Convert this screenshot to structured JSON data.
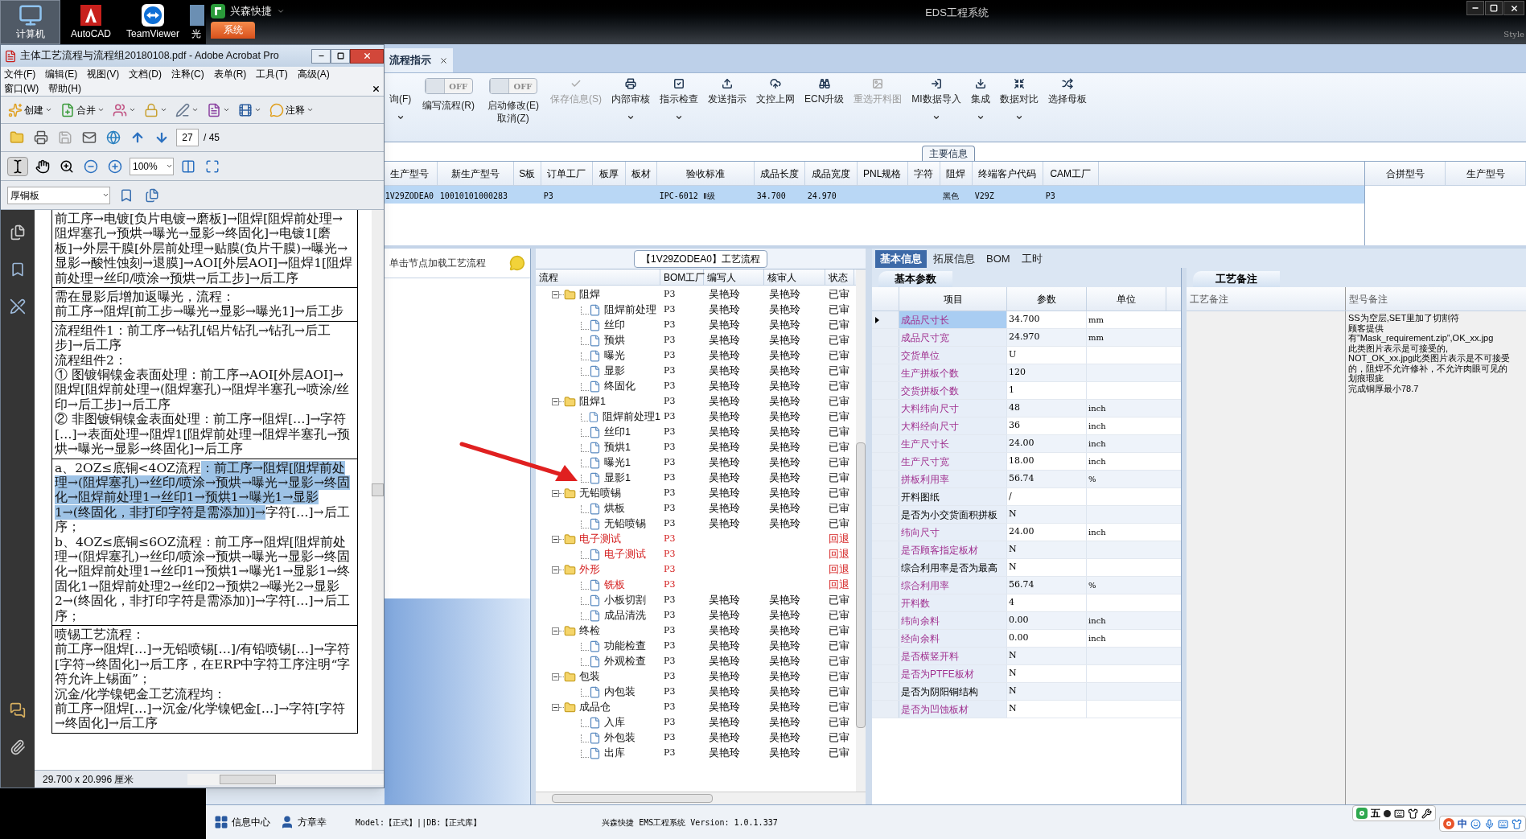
{
  "desktop": {
    "icons": [
      {
        "label": "计算机",
        "selected": true
      },
      {
        "label": "AutoCAD",
        "selected": false
      },
      {
        "label": "TeamViewer",
        "selected": false
      },
      {
        "label": "光",
        "selected": false
      }
    ]
  },
  "eds": {
    "app_name": "兴森快捷",
    "system_tab": "系统",
    "title": "EDS工程系统",
    "style_label": "Style",
    "doc_tab": {
      "label": "流程指示"
    },
    "ribbon": [
      {
        "kind": "button",
        "label": "询(F)",
        "disabled": false,
        "dropdown": true
      },
      {
        "kind": "toggle",
        "state_text": "OFF",
        "on": false,
        "label": "编写流程(R)"
      },
      {
        "kind": "toggle",
        "state_text": "OFF",
        "on": false,
        "label": "启动修改(E)",
        "sublabel": "取消(Z)"
      },
      {
        "kind": "button",
        "label": "保存信息(S)",
        "disabled": true,
        "dropdown": false
      },
      {
        "kind": "button",
        "label": "内部审核",
        "disabled": false,
        "dropdown": true
      },
      {
        "kind": "button",
        "label": "指示检查",
        "disabled": false,
        "dropdown": true
      },
      {
        "kind": "button",
        "label": "发送指示",
        "disabled": false,
        "dropdown": false
      },
      {
        "kind": "button",
        "label": "文控上网",
        "disabled": false,
        "dropdown": false
      },
      {
        "kind": "button",
        "label": "ECN升级",
        "disabled": false,
        "dropdown": false
      },
      {
        "kind": "button",
        "label": "重选开料图",
        "disabled": true,
        "dropdown": false
      },
      {
        "kind": "button",
        "label": "MI数据导入",
        "disabled": false,
        "dropdown": true
      },
      {
        "kind": "button",
        "label": "集成",
        "disabled": false,
        "dropdown": true
      },
      {
        "kind": "button",
        "label": "数据对比",
        "disabled": false,
        "dropdown": true
      },
      {
        "kind": "button",
        "label": "选择母板",
        "disabled": false,
        "dropdown": false
      }
    ],
    "group_label": "主要信息",
    "main_table": {
      "columns": [
        "生产型号",
        "新生产型号",
        "S板",
        "订单工厂",
        "板厚",
        "板材",
        "验收标准",
        "成品长度",
        "成品宽度",
        "PNL规格",
        "字符",
        "阻焊",
        "终端客户代码",
        "CAM工厂"
      ],
      "rows": [
        {
          "selected": true,
          "cells": [
            "1V29ZODEA0",
            "10010101000283",
            "",
            "P3",
            "",
            "",
            "IPC-6012 Ⅱ级",
            "34.700",
            "24.970",
            "",
            "",
            "黑色",
            "V29Z",
            "P3"
          ]
        }
      ]
    },
    "merge_panel": {
      "columns": [
        "合拼型号",
        "生产型号"
      ]
    },
    "left_panel": {
      "hint": "单击节点加载工艺流程"
    },
    "tree": {
      "title": "【1V29ZODEA0】工艺流程",
      "columns": [
        "流程",
        "BOM工厂",
        "编写人",
        "核审人",
        "状态"
      ],
      "nodes": [
        {
          "label": "阻焊",
          "bom": "P3",
          "writer": "吴艳玲",
          "reviewer": "吴艳玲",
          "status": "已审",
          "returned": false,
          "expanded": true,
          "children": [
            {
              "label": "阻焊前处理",
              "bom": "P3",
              "writer": "吴艳玲",
              "reviewer": "吴艳玲",
              "status": "已审",
              "returned": false
            },
            {
              "label": "丝印",
              "bom": "P3",
              "writer": "吴艳玲",
              "reviewer": "吴艳玲",
              "status": "已审",
              "returned": false
            },
            {
              "label": "预烘",
              "bom": "P3",
              "writer": "吴艳玲",
              "reviewer": "吴艳玲",
              "status": "已审",
              "returned": false
            },
            {
              "label": "曝光",
              "bom": "P3",
              "writer": "吴艳玲",
              "reviewer": "吴艳玲",
              "status": "已审",
              "returned": false
            },
            {
              "label": "显影",
              "bom": "P3",
              "writer": "吴艳玲",
              "reviewer": "吴艳玲",
              "status": "已审",
              "returned": false
            },
            {
              "label": "终固化",
              "bom": "P3",
              "writer": "吴艳玲",
              "reviewer": "吴艳玲",
              "status": "已审",
              "returned": false
            }
          ]
        },
        {
          "label": "阻焊1",
          "bom": "P3",
          "writer": "吴艳玲",
          "reviewer": "吴艳玲",
          "status": "已审",
          "returned": false,
          "expanded": true,
          "children": [
            {
              "label": "阻焊前处理1",
              "bom": "P3",
              "writer": "吴艳玲",
              "reviewer": "吴艳玲",
              "status": "已审",
              "returned": false
            },
            {
              "label": "丝印1",
              "bom": "P3",
              "writer": "吴艳玲",
              "reviewer": "吴艳玲",
              "status": "已审",
              "returned": false
            },
            {
              "label": "预烘1",
              "bom": "P3",
              "writer": "吴艳玲",
              "reviewer": "吴艳玲",
              "status": "已审",
              "returned": false
            },
            {
              "label": "曝光1",
              "bom": "P3",
              "writer": "吴艳玲",
              "reviewer": "吴艳玲",
              "status": "已审",
              "returned": false
            },
            {
              "label": "显影1",
              "bom": "P3",
              "writer": "吴艳玲",
              "reviewer": "吴艳玲",
              "status": "已审",
              "returned": false
            }
          ]
        },
        {
          "label": "无铅喷锡",
          "bom": "P3",
          "writer": "吴艳玲",
          "reviewer": "吴艳玲",
          "status": "已审",
          "returned": false,
          "expanded": true,
          "children": [
            {
              "label": "烘板",
              "bom": "P3",
              "writer": "吴艳玲",
              "reviewer": "吴艳玲",
              "status": "已审",
              "returned": false
            },
            {
              "label": "无铅喷锡",
              "bom": "P3",
              "writer": "吴艳玲",
              "reviewer": "吴艳玲",
              "status": "已审",
              "returned": false
            }
          ]
        },
        {
          "label": "电子测试",
          "bom": "P3",
          "status": "回退",
          "returned": true,
          "expanded": true,
          "children": [
            {
              "label": "电子测试",
              "bom": "P3",
              "status": "回退",
              "returned": true
            }
          ]
        },
        {
          "label": "外形",
          "bom": "P3",
          "status": "回退",
          "returned": true,
          "expanded": true,
          "children": [
            {
              "label": "铣板",
              "bom": "P3",
              "status": "回退",
              "returned": true
            },
            {
              "label": "小板切割",
              "bom": "P3",
              "writer": "吴艳玲",
              "reviewer": "吴艳玲",
              "status": "已审",
              "returned": false
            },
            {
              "label": "成品清洗",
              "bom": "P3",
              "writer": "吴艳玲",
              "reviewer": "吴艳玲",
              "status": "已审",
              "returned": false
            }
          ]
        },
        {
          "label": "终检",
          "bom": "P3",
          "writer": "吴艳玲",
          "reviewer": "吴艳玲",
          "status": "已审",
          "returned": false,
          "expanded": true,
          "children": [
            {
              "label": "功能检查",
              "bom": "P3",
              "writer": "吴艳玲",
              "reviewer": "吴艳玲",
              "status": "已审",
              "returned": false
            },
            {
              "label": "外观检查",
              "bom": "P3",
              "writer": "吴艳玲",
              "reviewer": "吴艳玲",
              "status": "已审",
              "returned": false
            }
          ]
        },
        {
          "label": "包装",
          "bom": "P3",
          "writer": "吴艳玲",
          "reviewer": "吴艳玲",
          "status": "已审",
          "returned": false,
          "expanded": true,
          "children": [
            {
              "label": "内包装",
              "bom": "P3",
              "writer": "吴艳玲",
              "reviewer": "吴艳玲",
              "status": "已审",
              "returned": false
            }
          ]
        },
        {
          "label": "成品仓",
          "bom": "P3",
          "writer": "吴艳玲",
          "reviewer": "吴艳玲",
          "status": "已审",
          "returned": false,
          "expanded": true,
          "children": [
            {
              "label": "入库",
              "bom": "P3",
              "writer": "吴艳玲",
              "reviewer": "吴艳玲",
              "status": "已审",
              "returned": false
            },
            {
              "label": "外包装",
              "bom": "P3",
              "writer": "吴艳玲",
              "reviewer": "吴艳玲",
              "status": "已审",
              "returned": false
            },
            {
              "label": "出库",
              "bom": "P3",
              "writer": "吴艳玲",
              "reviewer": "吴艳玲",
              "status": "已审",
              "returned": false
            }
          ]
        }
      ]
    },
    "info": {
      "tabs": [
        {
          "label": "基本信息",
          "selected": true
        },
        {
          "label": "拓展信息",
          "selected": false
        },
        {
          "label": "BOM",
          "selected": false
        },
        {
          "label": "工时",
          "selected": false
        }
      ],
      "params": {
        "title": "基本参数",
        "columns": [
          "项目",
          "参数",
          "单位"
        ],
        "rows": [
          {
            "item": "成品尺寸长",
            "value": "34.700",
            "unit": "mm",
            "required": true,
            "selected": true
          },
          {
            "item": "成品尺寸宽",
            "value": "24.970",
            "unit": "mm",
            "required": true,
            "selected": false
          },
          {
            "item": "交货单位",
            "value": "U",
            "required": true,
            "selected": false
          },
          {
            "item": "生产拼板个数",
            "value": "120",
            "required": true,
            "selected": false
          },
          {
            "item": "交货拼板个数",
            "value": "1",
            "required": true,
            "selected": false
          },
          {
            "item": "大料纬向尺寸",
            "value": "48",
            "unit": "inch",
            "required": true,
            "selected": false
          },
          {
            "item": "大料经向尺寸",
            "value": "36",
            "unit": "inch",
            "required": true,
            "selected": false
          },
          {
            "item": "生产尺寸长",
            "value": "24.00",
            "unit": "inch",
            "required": true,
            "selected": false
          },
          {
            "item": "生产尺寸宽",
            "value": "18.00",
            "unit": "inch",
            "required": true,
            "selected": false
          },
          {
            "item": "拼板利用率",
            "value": "56.74",
            "unit": "%",
            "required": true,
            "selected": false
          },
          {
            "item": "开料图纸",
            "value": "/",
            "required": false,
            "selected": false
          },
          {
            "item": "是否为小交货面积拼板",
            "value": "N",
            "required": false,
            "selected": false
          },
          {
            "item": "纬向尺寸",
            "value": "24.00",
            "unit": "inch",
            "required": true,
            "selected": false
          },
          {
            "item": "是否顾客指定板材",
            "value": "N",
            "required": true,
            "selected": false
          },
          {
            "item": "综合利用率是否为最高",
            "value": "N",
            "required": false,
            "selected": false
          },
          {
            "item": "综合利用率",
            "value": "56.74",
            "unit": "%",
            "required": true,
            "selected": false
          },
          {
            "item": "开料数",
            "value": "4",
            "required": true,
            "selected": false
          },
          {
            "item": "纬向余料",
            "value": "0.00",
            "unit": "inch",
            "required": true,
            "selected": false
          },
          {
            "item": "经向余料",
            "value": "0.00",
            "unit": "inch",
            "required": true,
            "selected": false
          },
          {
            "item": "是否横竖开料",
            "value": "N",
            "required": true,
            "selected": false
          },
          {
            "item": "是否为PTFE板材",
            "value": "N",
            "required": true,
            "selected": false
          },
          {
            "item": "是否为阴阳铜结构",
            "value": "N",
            "required": false,
            "selected": false
          },
          {
            "item": "是否为凹蚀板材",
            "value": "N",
            "required": true,
            "selected": false
          }
        ]
      },
      "notes": {
        "title": "工艺备注",
        "columns": [
          "工艺备注",
          "型号备注"
        ],
        "model_note_lines": [
          "SS为空层,SET里加了切割符",
          "顾客提供",
          "有”Mask_requirement.zip”,OK_xx.jpg",
          "此类图片表示是可接受的,",
          "NOT_OK_xx.jpg此类图片表示是不可接受",
          "的，阻焊不允许修补，不允许肉眼可见的",
          "划痕瑕疵",
          "完成铜厚最小78.7"
        ]
      }
    },
    "status_bar": {
      "buttons": [
        {
          "label": "信息中心"
        },
        {
          "label": "方章幸"
        }
      ],
      "model": "Model:【正式】||DB:【正式库】",
      "version": "兴森快捷 EMS工程系统 Version: 1.0.1.337"
    },
    "ime_bars": [
      {
        "mode": "五"
      },
      {
        "mode": "中"
      }
    ]
  },
  "acrobat": {
    "title": "主体工艺流程与流程组20180108.pdf - Adobe Acrobat Pro",
    "menus": [
      [
        {
          "label": "文件(F)"
        },
        {
          "label": "编辑(E)"
        },
        {
          "label": "视图(V)"
        },
        {
          "label": "文档(D)"
        },
        {
          "label": "注释(C)"
        },
        {
          "label": "表单(R)"
        },
        {
          "label": "工具(T)"
        },
        {
          "label": "高级(A)"
        }
      ],
      [
        {
          "label": "窗口(W)"
        },
        {
          "label": "帮助(H)"
        }
      ]
    ],
    "create": "创建",
    "merge": "合并",
    "comment": "注释",
    "page": "27",
    "page_total": "/ 45",
    "zoom": "100%",
    "tools": [
      {
        "selected": true
      },
      {
        "selected": false
      },
      {
        "selected": false
      }
    ],
    "search_dropdown": "厚铜板",
    "rows": [
      {
        "paragraphs": [
          {
            "text": "前工序→电镀[负片电镀→磨板]→阻焊[阻焊前处理→阻焊塞孔→预烘→曝光→显影→终固化]→电镀1[磨板]→外层干膜[外层前处理→贴膜(负片干膜)→曝光→显影→酸性蚀刻→退膜]→AOI[外层AOI]→阻焊1[阻焊前处理→丝印/喷涂→预烘→后工步]→后工序",
            "highlighted": false
          }
        ]
      },
      {
        "paragraphs": [
          {
            "text": "需在显影后增加返曝光，流程：",
            "highlighted": false
          },
          {
            "text": "前工序→阻焊[前工步→曝光→显影→曝光1]→后工步",
            "highlighted": false
          }
        ]
      },
      {
        "paragraphs": [
          {
            "text": "流程组件1：前工序→钻孔[铝片钻孔→钻孔→后工步]→后工序",
            "highlighted": false
          },
          {
            "text": "流程组件2：",
            "highlighted": false
          },
          {
            "text": "① 图镀铜镍金表面处理：前工序→AOI[外层AOI]→阻焊[阻焊前处理→(阻焊塞孔)→阻焊半塞孔→喷涂/丝印→后工步]→后工序",
            "highlighted": false
          },
          {
            "text": "② 非图镀铜镍金表面处理：前工序→阻焊[…]→字符[…]→表面处理→阻焊1[阻焊前处理→阻焊半塞孔→预烘→曝光→显影→终固化]→后工序",
            "highlighted": false
          }
        ]
      },
      {
        "paragraphs": [
          {
            "parts": [
              {
                "text": "a、2OZ≤底铜<4OZ流程",
                "highlighted": false
              },
              {
                "text": "：前工序→阻焊[阻焊前处理→(阻焊塞孔)→丝印/喷涂→预烘→曝光→显影→终固化→阻焊前处理1→丝印1→预烘1→曝光1→显影1→(终固化，非打印字符是需添加)]→",
                "highlighted": true
              },
              {
                "text": "字符[…]→后工序；",
                "highlighted": false
              }
            ]
          },
          {
            "text": "b、4OZ≤底铜≤6OZ流程：前工序→阻焊[阻焊前处理→(阻焊塞孔)→丝印/喷涂→预烘→曝光→显影→终固化→阻焊前处理1→丝印1→预烘1→曝光1→显影1→终固化1→阻焊前处理2→丝印2→预烘2→曝光2→显影2→(终固化，非打印字符是需添加)]→字符[…]→后工序；",
            "highlighted": false
          }
        ]
      },
      {
        "paragraphs": [
          {
            "text": "喷锡工艺流程：",
            "highlighted": false
          },
          {
            "text": "前工序→阻焊[…]→无铅喷锡[…]/有铅喷锡[…]→字符[字符→终固化]→后工序，在ERP中字符工序注明“字符允许上锡面”；",
            "highlighted": false
          },
          {
            "text": "沉金/化学镍钯金工艺流程均：",
            "highlighted": false
          },
          {
            "text": "前工序→阻焊[…]→沉金/化学镍钯金[…]→字符[字符→终固化]→后工序",
            "highlighted": false
          }
        ]
      }
    ],
    "page_size": "29.700 x 20.996 厘米"
  }
}
